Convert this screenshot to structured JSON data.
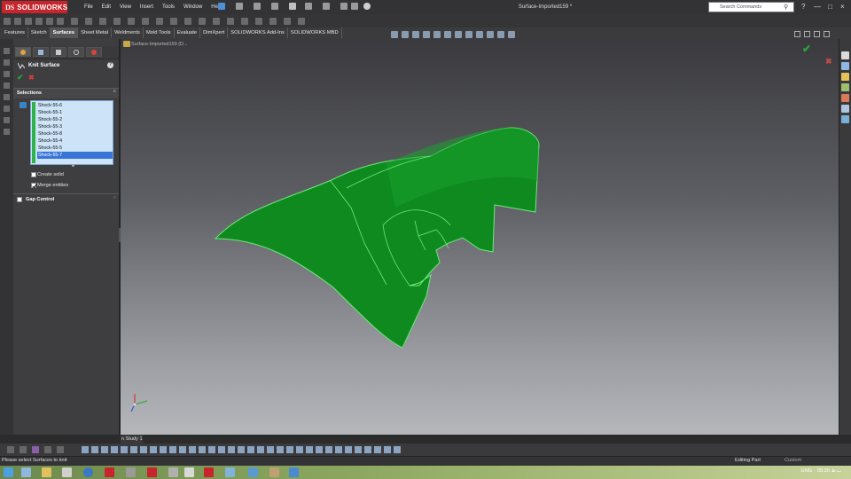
{
  "app": {
    "logo_ds": "DS",
    "logo_name": "SOLIDWORKS",
    "doc_title": "Surface-Imported159 *"
  },
  "menu": [
    "File",
    "Edit",
    "View",
    "Insert",
    "Tools",
    "Window",
    "Help"
  ],
  "search": {
    "placeholder": "Search Commands"
  },
  "tabs": [
    "Features",
    "Sketch",
    "Surfaces",
    "Sheet Metal",
    "Weldments",
    "Mold Tools",
    "Evaluate",
    "DimXpert",
    "SOLIDWORKS Add-Ins",
    "SOLIDWORKS MBD"
  ],
  "active_tab": "Surfaces",
  "property_manager": {
    "title": "Knit Surface",
    "help": "?",
    "selections_label": "Selections",
    "selections": [
      "Shock-55-6",
      "Shock-55-1",
      "Shock-55-2",
      "Shock-55-3",
      "Shock-55-8",
      "Shock-55-4",
      "Shock-55-5",
      "Shock-55-7"
    ],
    "selected_index": 7,
    "create_solid": {
      "label": "Create solid",
      "checked": false
    },
    "merge_entities": {
      "label": "Merge entities",
      "checked": true
    },
    "gap_control": {
      "label": "Gap Control",
      "checked": false
    }
  },
  "viewport": {
    "tree_label": "Surface-Imported159 (D..."
  },
  "motion_tab": "n Study 1",
  "status": {
    "message": "Please select Surfaces to knit",
    "mode": "Editing Part",
    "units": "Custom"
  },
  "taskbar": {
    "lang": "ENG",
    "time": "05:20 ب.ظ"
  },
  "colors": {
    "model_fill": "#0f8a1f",
    "model_edge": "#6dea7a",
    "accent_red": "#c8242b",
    "selection_bg": "#cde3f7"
  }
}
